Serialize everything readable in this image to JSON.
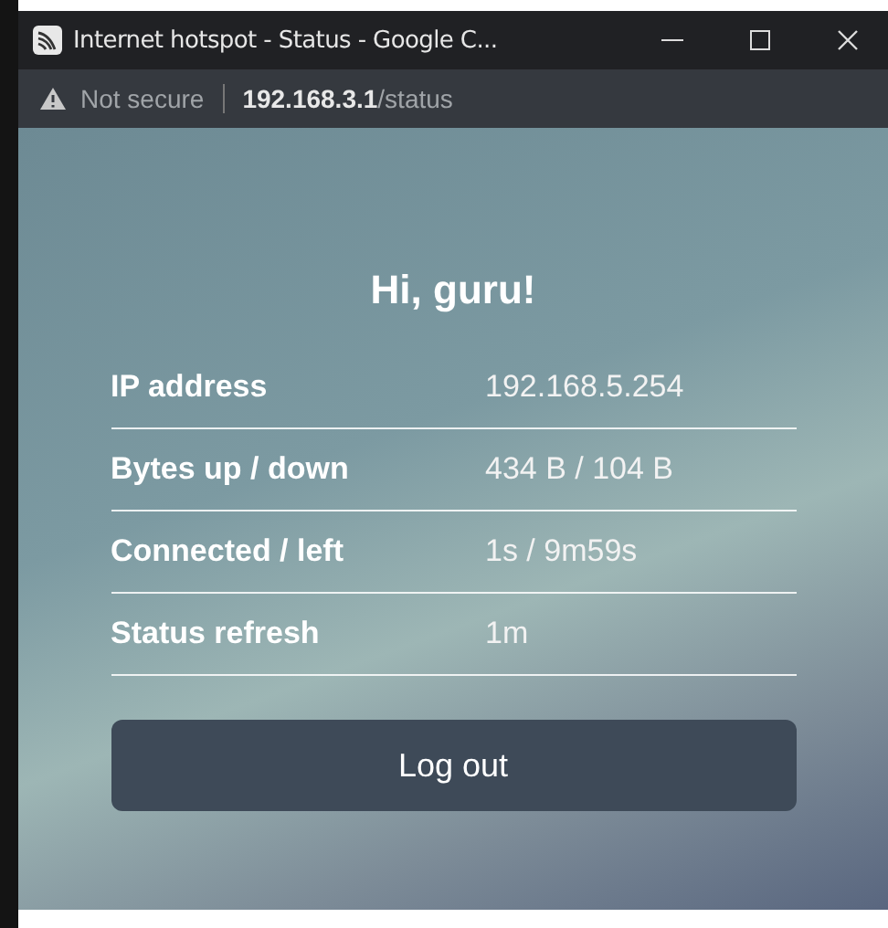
{
  "window": {
    "title": "Internet hotspot - Status - Google C..."
  },
  "address_bar": {
    "security": "Not secure",
    "host": "192.168.3.1",
    "path": "/status"
  },
  "greeting": "Hi, guru!",
  "rows": [
    {
      "label": "IP address",
      "value": "192.168.5.254"
    },
    {
      "label": "Bytes up / down",
      "value": "434 B / 104 B"
    },
    {
      "label": "Connected / left",
      "value": "1s / 9m59s"
    },
    {
      "label": "Status refresh",
      "value": "1m"
    }
  ],
  "button": "Log out"
}
